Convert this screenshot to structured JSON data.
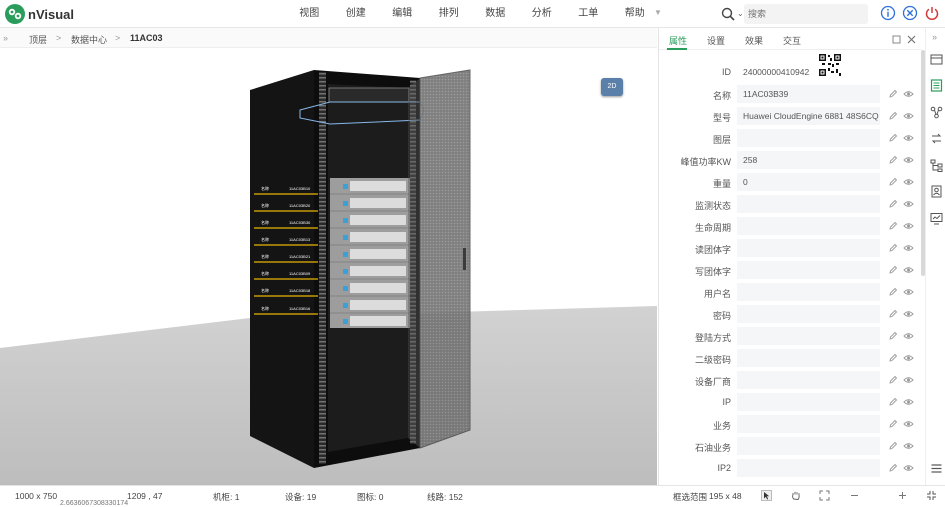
{
  "app": {
    "brand": "nVisual"
  },
  "menu": [
    "视图",
    "创建",
    "编辑",
    "排列",
    "数据",
    "分析",
    "工单",
    "帮助"
  ],
  "search": {
    "placeholder": "搜索"
  },
  "breadcrumb": {
    "items": [
      "顶层",
      "数据中心",
      "11AC03"
    ]
  },
  "viewport": {
    "toggle_2d": "2D"
  },
  "rack_labels": [
    {
      "name": "名称",
      "code": "11AC03B10"
    },
    {
      "name": "名称",
      "code": "11AC03B20"
    },
    {
      "name": "名称",
      "code": "11AC03B30"
    },
    {
      "name": "名称",
      "code": "11AC03B13"
    },
    {
      "name": "名称",
      "code": "11AC03B21"
    },
    {
      "name": "名称",
      "code": "11AC03B09"
    },
    {
      "name": "名称",
      "code": "11AC03B18"
    },
    {
      "name": "名称",
      "code": "11AC03B16"
    }
  ],
  "panel": {
    "tabs": [
      "属性",
      "设置",
      "效果",
      "交互"
    ],
    "active_tab": "属性",
    "properties": [
      {
        "label": "ID",
        "value": "24000000410942"
      },
      {
        "label": "名称",
        "value": "11AC03B39"
      },
      {
        "label": "型号",
        "value": "Huawei CloudEngine 6881 48S6CQ"
      },
      {
        "label": "图层",
        "value": ""
      },
      {
        "label": "峰值功率KW",
        "value": "258"
      },
      {
        "label": "重量",
        "value": "0"
      },
      {
        "label": "监测状态",
        "value": ""
      },
      {
        "label": "生命周期",
        "value": ""
      },
      {
        "label": "读团体字",
        "value": ""
      },
      {
        "label": "写团体字",
        "value": ""
      },
      {
        "label": "用户名",
        "value": ""
      },
      {
        "label": "密码",
        "value": ""
      },
      {
        "label": "登陆方式",
        "value": ""
      },
      {
        "label": "二级密码",
        "value": ""
      },
      {
        "label": "设备厂商",
        "value": ""
      },
      {
        "label": "IP",
        "value": ""
      },
      {
        "label": "业务",
        "value": ""
      },
      {
        "label": "石油业务",
        "value": ""
      },
      {
        "label": "IP2",
        "value": ""
      }
    ]
  },
  "status": {
    "canvas_size": "1000 x 750",
    "cursor": "1209 , 47",
    "cursor_sub": "2.6636067308330174",
    "racks": "机柜: 1",
    "devices": "设备: 19",
    "icons": "图标: 0",
    "lines": "线路: 152",
    "selection_label": "框选范围",
    "selection_value": "195 x 48"
  },
  "colors": {
    "accent": "#2a9d5c",
    "info": "#2f6fd8",
    "danger": "#d23b3b"
  }
}
